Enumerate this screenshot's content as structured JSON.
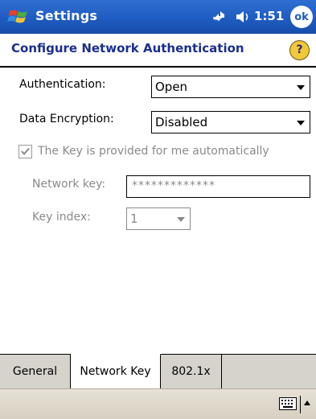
{
  "titlebar": {
    "app_title": "Settings",
    "time": "1:51",
    "ok_label": "ok"
  },
  "header": {
    "title": "Configure Network Authentication",
    "help_label": "?"
  },
  "form": {
    "authentication": {
      "label": "Authentication:",
      "value": "Open"
    },
    "data_encryption": {
      "label": "Data Encryption:",
      "value": "Disabled"
    },
    "auto_key": {
      "label": "The Key is provided for me automatically",
      "checked": true
    },
    "network_key": {
      "label": "Network key:",
      "value": "*************"
    },
    "key_index": {
      "label": "Key index:",
      "value": "1"
    }
  },
  "tabs": [
    {
      "label": "General"
    },
    {
      "label": "Network Key"
    },
    {
      "label": "802.1x"
    }
  ],
  "icons": {
    "start": "windows-start-icon",
    "connectivity": "connectivity-icon",
    "volume": "speaker-icon",
    "help": "help-icon",
    "keyboard": "keyboard-icon"
  }
}
